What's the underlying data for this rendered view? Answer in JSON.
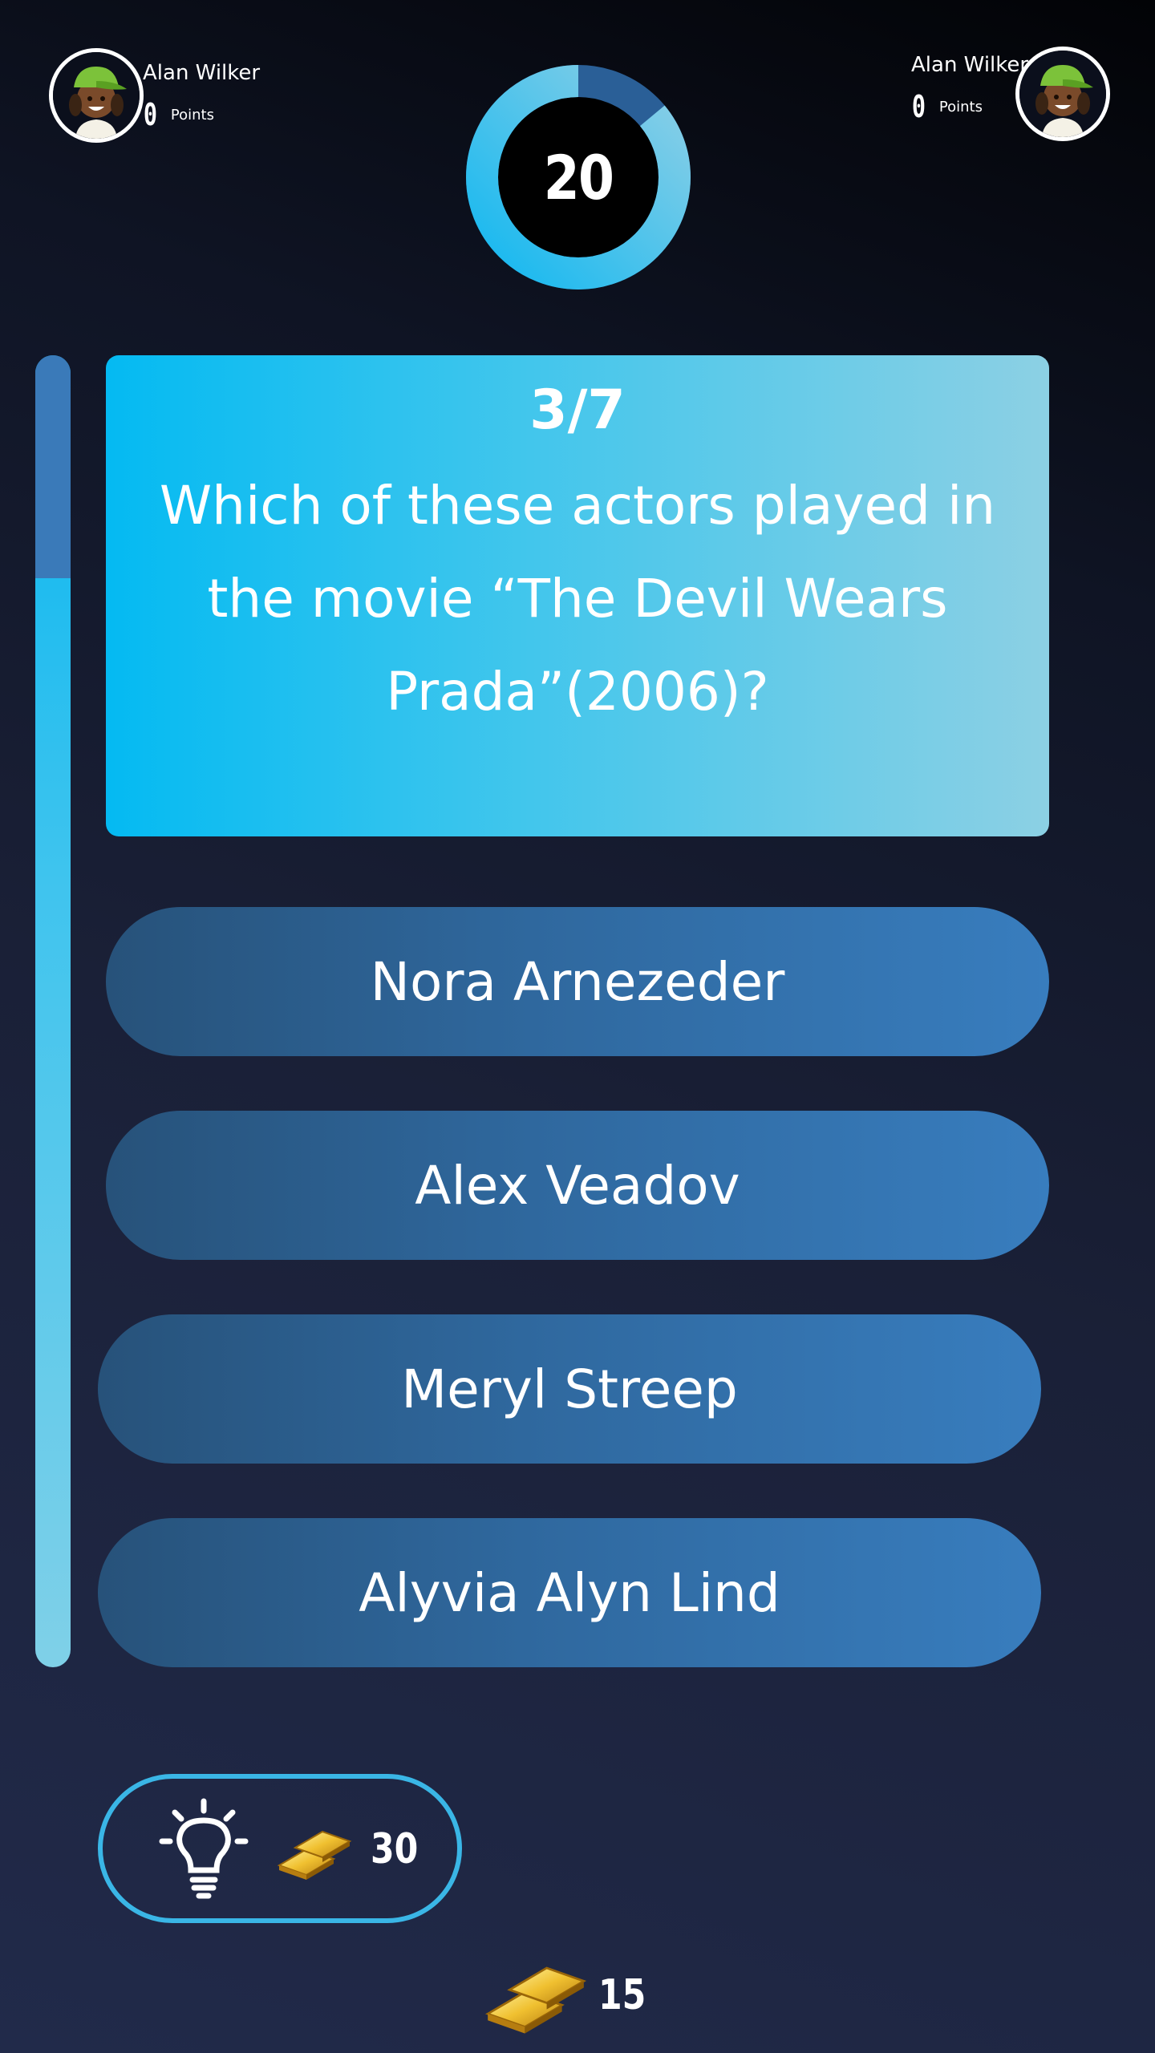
{
  "player_left": {
    "name": "Alan Wilker",
    "points": "0",
    "points_label": "Points"
  },
  "player_right": {
    "name": "Alan Wilker",
    "points": "0",
    "points_label": "Points"
  },
  "timer": {
    "value": "20",
    "remaining_fraction": 0.86
  },
  "progress": {
    "remaining_fraction": 0.83
  },
  "question": {
    "counter": "3/7",
    "text": "Which of these actors played in the movie “The Devil Wears Prada”(2006)?"
  },
  "answers": [
    "Nora Arnezeder",
    "Alex Veadov",
    "Meryl Streep",
    "Alyvia Alyn Lind"
  ],
  "hint": {
    "icon": "lightbulb-icon",
    "cost": "30"
  },
  "wallet": {
    "coins": "15"
  },
  "colors": {
    "accent": "#04baf2",
    "answer_bg": "#2f689e",
    "timer_elapsed": "#2a5f97",
    "hint_border": "#3ab6e6"
  }
}
